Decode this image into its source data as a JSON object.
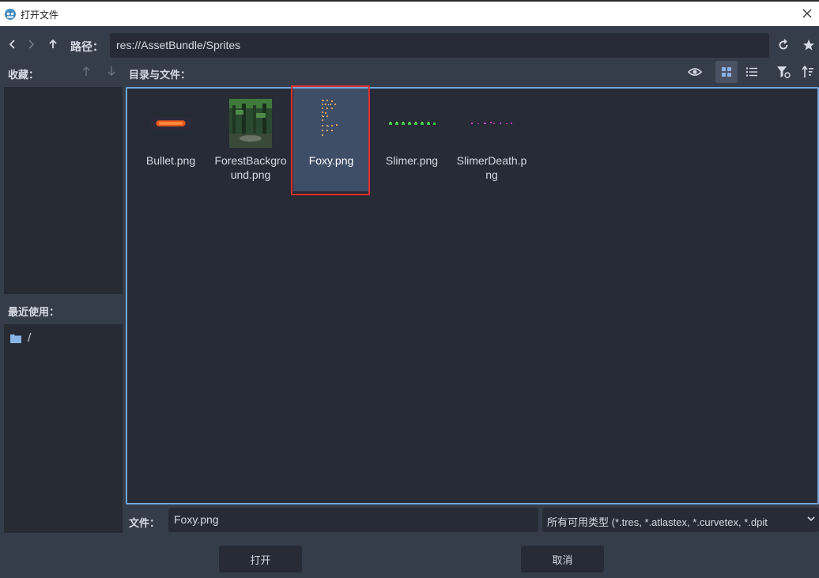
{
  "window": {
    "title": "打开文件"
  },
  "pathbar": {
    "label": "路径：",
    "path": "res://AssetBundle/Sprites"
  },
  "sidebar": {
    "favorites_label": "收藏：",
    "recent_label": "最近使用：",
    "recent_items": [
      "/"
    ]
  },
  "files": {
    "label": "目录与文件：",
    "items": [
      {
        "name": "Bullet.png"
      },
      {
        "name": "ForestBackground.png"
      },
      {
        "name": "Foxy.png",
        "selected": true
      },
      {
        "name": "Slimer.png"
      },
      {
        "name": "SlimerDeath.png"
      }
    ]
  },
  "footer": {
    "filename_label": "文件：",
    "filename": "Foxy.png",
    "filter": "所有可用类型 (*.tres, *.atlastex, *.curvetex, *.dpit",
    "open_label": "打开",
    "cancel_label": "取消"
  },
  "colors": {
    "accent": "#71a8e0",
    "selection": "#3f4e67",
    "highlight": "#e03030"
  }
}
